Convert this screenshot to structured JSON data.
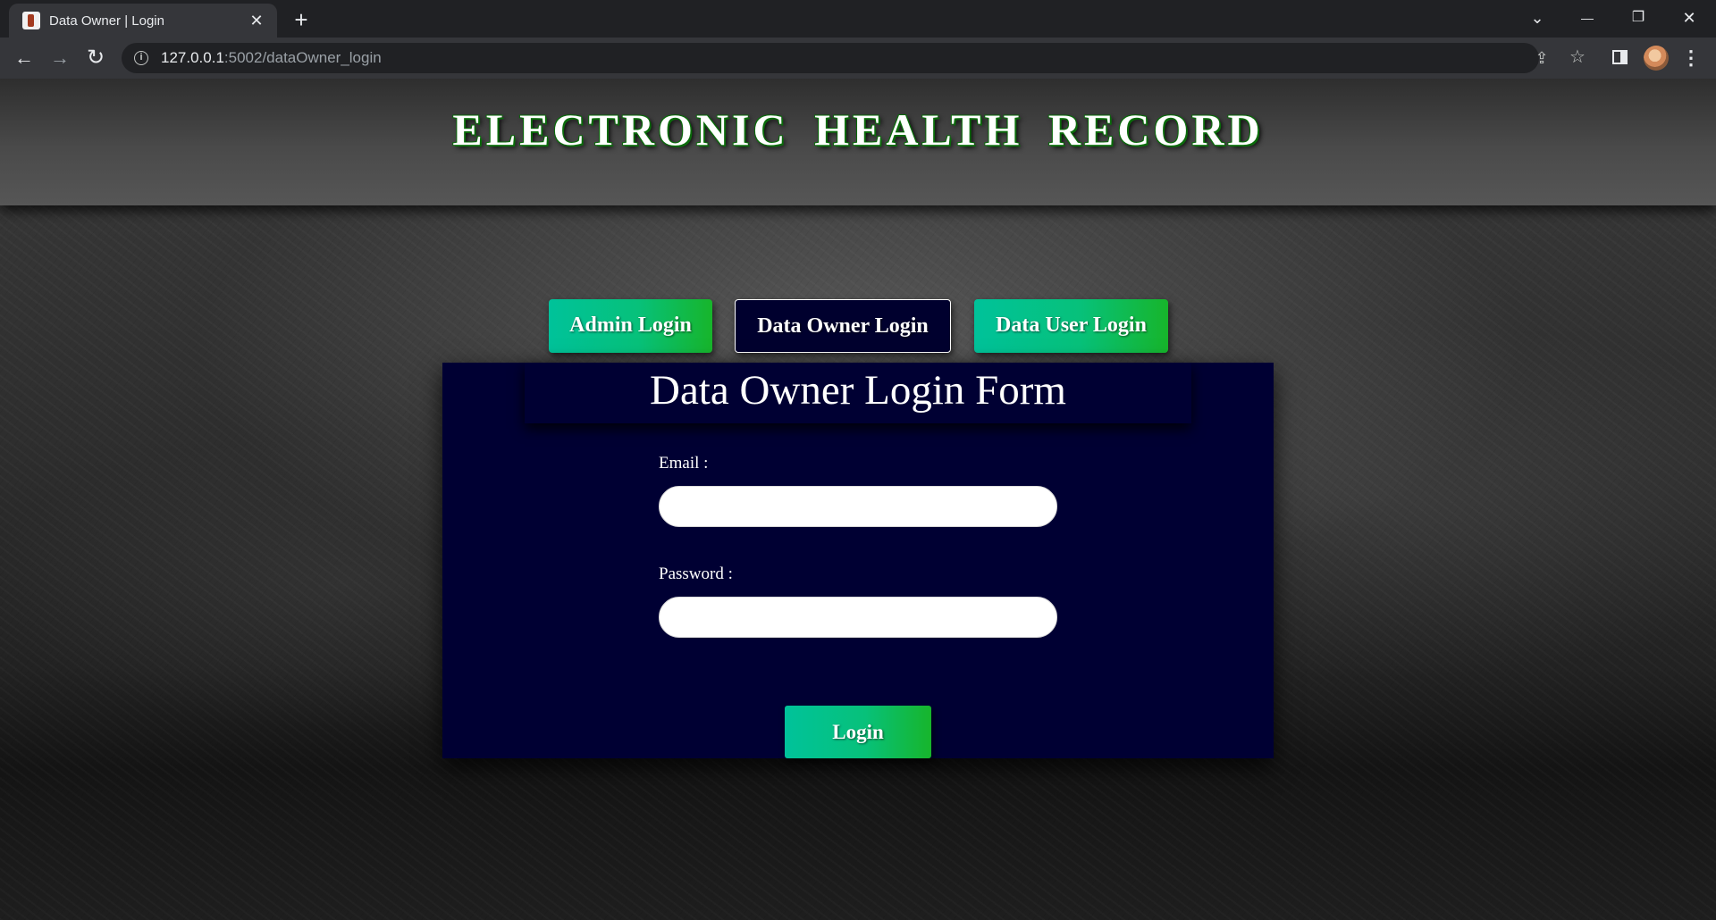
{
  "browser": {
    "tab": {
      "title": "Data Owner | Login",
      "favicon": "book-favicon-icon",
      "close_glyph": "✕"
    },
    "new_tab_glyph": "+",
    "window_controls": {
      "tab_search_glyph": "⌄",
      "minimize_glyph": "—",
      "restore_glyph": "❐",
      "close_glyph": "✕"
    },
    "toolbar": {
      "back_glyph": "←",
      "forward_glyph": "→",
      "reload_glyph": "↻",
      "info_glyph": "i",
      "url_host": "127.0.0.1",
      "url_rest": ":5002/dataOwner_login",
      "share_glyph": "⇪",
      "bookmark_glyph": "☆",
      "menu_glyph": "⋮"
    }
  },
  "page": {
    "site_title": "ELECTRONIC HEALTH RECORD",
    "nav_tabs": [
      {
        "label": "Admin Login",
        "active": false
      },
      {
        "label": "Data Owner Login",
        "active": true
      },
      {
        "label": "Data User Login",
        "active": false
      }
    ],
    "form": {
      "heading": "Data Owner Login Form",
      "email_label": "Email :",
      "email_value": "",
      "password_label": "Password :",
      "password_value": "",
      "submit_label": "Login"
    },
    "colors": {
      "accent_green_start": "#00c29a",
      "accent_green_end": "#17b52b",
      "form_background": "#000033",
      "title_outline": "#0b6b0b"
    }
  }
}
